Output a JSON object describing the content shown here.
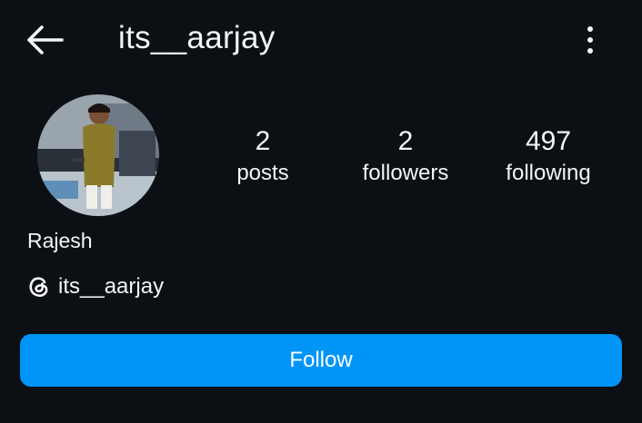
{
  "header": {
    "username": "its__aarjay",
    "back_icon": "arrow-left-icon",
    "more_icon": "vertical-ellipsis-icon"
  },
  "profile": {
    "avatar": "profile-photo",
    "display_name": "Rajesh",
    "threads_icon": "threads-icon",
    "threads_handle": "its__aarjay"
  },
  "stats": [
    {
      "value": "2",
      "label": "posts"
    },
    {
      "value": "2",
      "label": "followers"
    },
    {
      "value": "497",
      "label": "following"
    }
  ],
  "actions": {
    "follow_label": "Follow"
  },
  "colors": {
    "background": "#0c1014",
    "text": "#f5f5f5",
    "follow_button": "#0095f6"
  }
}
